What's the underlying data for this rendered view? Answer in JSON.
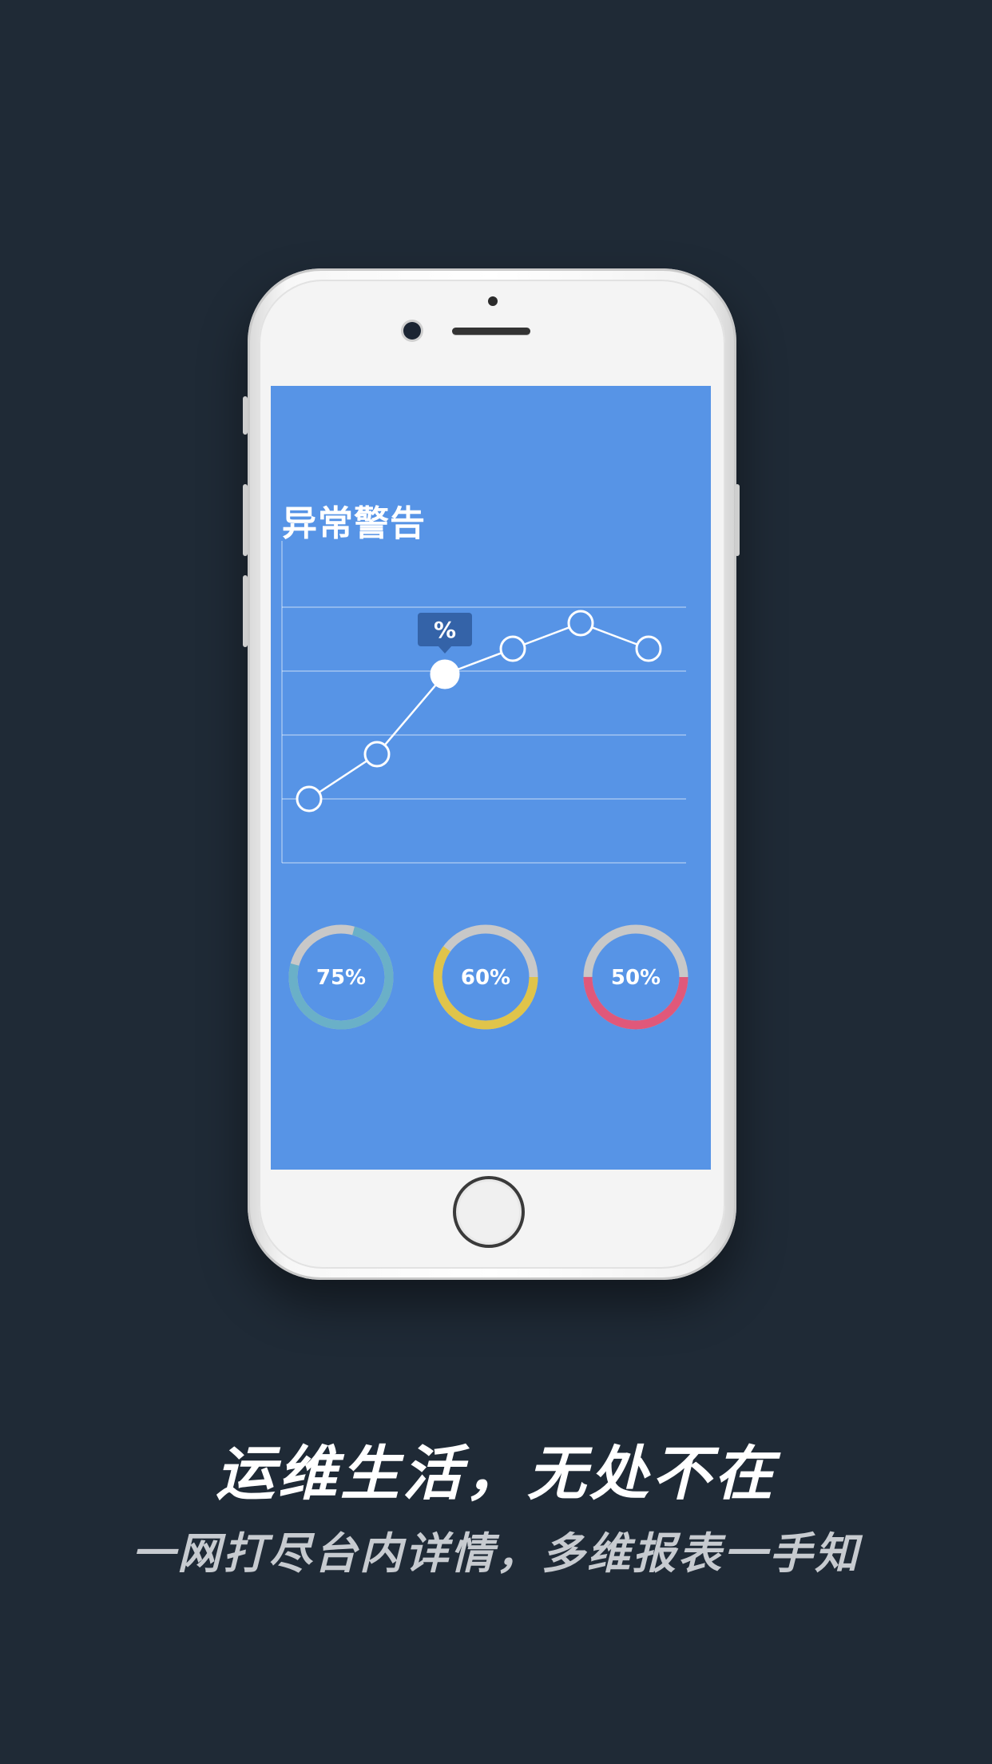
{
  "screen": {
    "title": "异常警告",
    "line_chart": {
      "type": "line",
      "values": [
        20,
        34,
        59,
        67,
        75,
        67
      ],
      "ylim": [
        0,
        100
      ],
      "highlight_index": 2,
      "tooltip": "%"
    },
    "rings": [
      {
        "label": "75%",
        "percent": 75,
        "color": "#6ab0c8"
      },
      {
        "label": "60%",
        "percent": 60,
        "color": "#e0c44a"
      },
      {
        "label": "50%",
        "percent": 50,
        "color": "#e0587a"
      }
    ]
  },
  "tagline": {
    "main": "运维生活，无处不在",
    "sub": "一网打尽台内详情，多维报表一手知"
  },
  "colors": {
    "background": "#1f2a36",
    "screen": "#5794e6",
    "ring_track": "#c8c8c8"
  },
  "chart_data": {
    "type": "line",
    "values": [
      20,
      34,
      59,
      67,
      75,
      67
    ],
    "ylim": [
      0,
      100
    ],
    "title": "",
    "xlabel": "",
    "ylabel": ""
  }
}
